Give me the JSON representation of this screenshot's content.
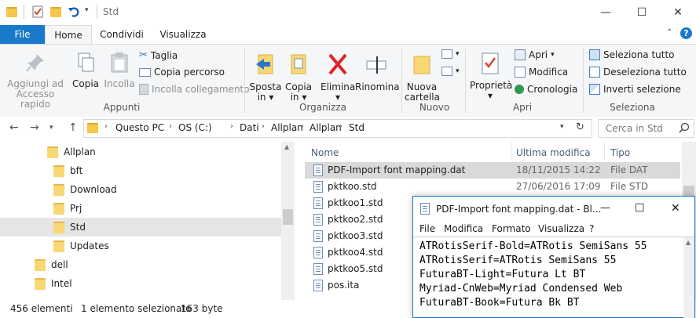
{
  "title_bar": {
    "title": "Std",
    "minimize": "—",
    "maximize": "☐",
    "close": "✕"
  },
  "tabs": {
    "file": "File",
    "home": "Home",
    "share": "Condividi",
    "view": "Visualizza"
  },
  "ribbon": {
    "pin": "Aggiungi ad Accesso rapido",
    "copy": "Copia",
    "paste": "Incolla",
    "cut": "Taglia",
    "copy_path": "Copia percorso",
    "paste_shortcut": "Incolla collegamento",
    "group_clipboard": "Appunti",
    "move_to_1": "Sposta",
    "move_to_2": "in",
    "copy_to_1": "Copia",
    "copy_to_2": "in",
    "delete": "Elimina",
    "rename": "Rinomina",
    "group_organize": "Organizza",
    "new_folder_1": "Nuova",
    "new_folder_2": "cartella",
    "group_new": "Nuovo",
    "properties": "Proprietà",
    "open": "Apri",
    "edit": "Modifica",
    "history": "Cronologia",
    "group_open": "Apri",
    "select_all": "Seleziona tutto",
    "select_none": "Deseleziona tutto",
    "invert_selection": "Inverti selezione",
    "group_select": "Seleziona"
  },
  "address": {
    "crumbs": [
      "Questo PC",
      "OS (C:)",
      "Dati",
      "Allplan",
      "Allplan",
      "Std"
    ],
    "search_placeholder": "Cerca in Std"
  },
  "tree": [
    {
      "label": "Allplan"
    },
    {
      "label": "bft"
    },
    {
      "label": "Download"
    },
    {
      "label": "Prj"
    },
    {
      "label": "Std"
    },
    {
      "label": "Updates"
    },
    {
      "label": "dell"
    },
    {
      "label": "Intel"
    }
  ],
  "file_list": {
    "columns": {
      "name": "Nome",
      "modified": "Ultima modifica",
      "type": "Tipo"
    },
    "rows": [
      {
        "name": "PDF-Import font mapping.dat",
        "modified": "18/11/2015 14:22",
        "type": "File DAT"
      },
      {
        "name": "pktkoo.std",
        "modified": "27/06/2016 17:09",
        "type": "File STD"
      },
      {
        "name": "pktkoo1.std",
        "modified": "",
        "type": ""
      },
      {
        "name": "pktkoo2.std",
        "modified": "",
        "type": ""
      },
      {
        "name": "pktkoo3.std",
        "modified": "",
        "type": ""
      },
      {
        "name": "pktkoo4.std",
        "modified": "",
        "type": ""
      },
      {
        "name": "pktkoo5.std",
        "modified": "",
        "type": ""
      },
      {
        "name": "pos.ita",
        "modified": "",
        "type": ""
      }
    ]
  },
  "status": {
    "count": "456 elementi",
    "selected": "1 elemento selezionato",
    "size": "163 byte"
  },
  "notepad": {
    "title": "PDF-Import font mapping.dat - Bl...",
    "menu": {
      "file": "File",
      "edit": "Modifica",
      "format": "Formato",
      "view": "Visualizza",
      "help": "?"
    },
    "lines": [
      "ATRotisSerif-Bold=ATRotis SemiSans 55",
      "ATRotisSerif=ATRotis SemiSans 55",
      "FuturaBT-Light=Futura Lt BT",
      "Myriad-CnWeb=Myriad Condensed Web",
      "FuturaBT-Book=Futura Bk BT"
    ]
  },
  "colors": {
    "accent": "#1979ca",
    "folder": "#f8d775",
    "selection": "#d9d9d9"
  }
}
